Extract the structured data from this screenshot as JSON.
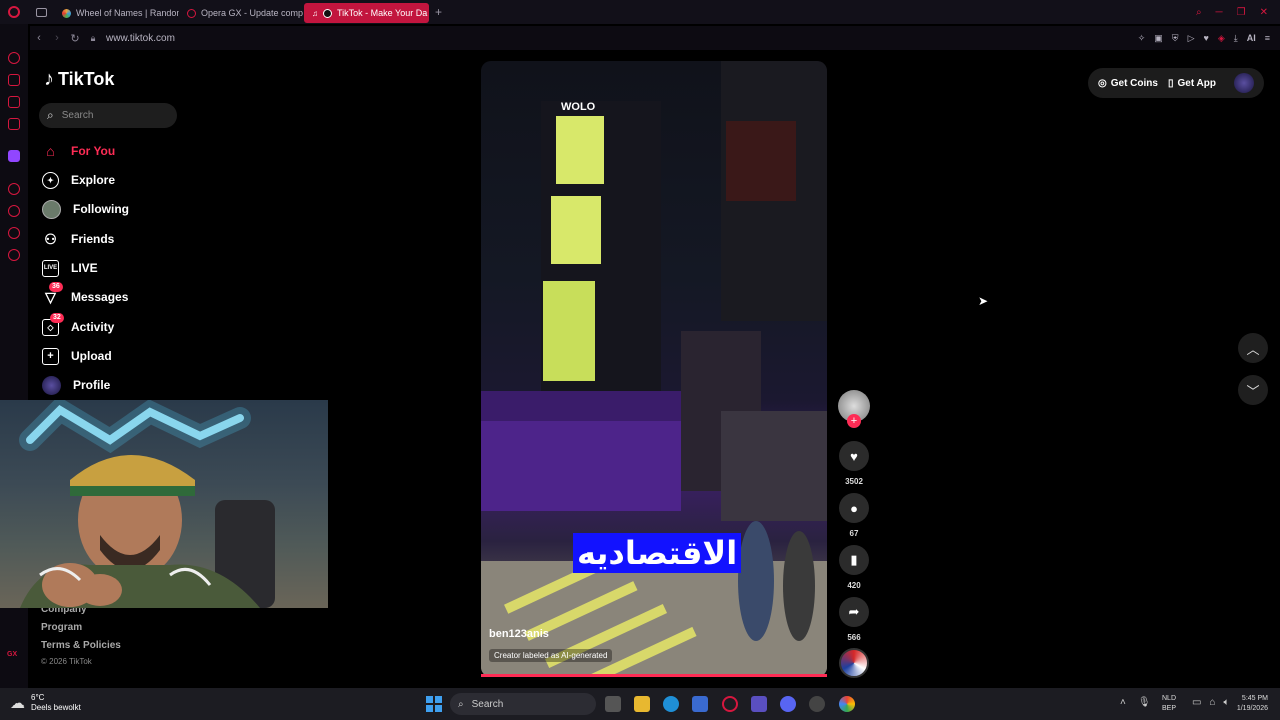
{
  "browser": {
    "tabs": [
      {
        "label": "Wheel of Names | Random",
        "color": "#e8a33c"
      },
      {
        "label": "Opera GX - Update comp",
        "color": "#d6173f"
      },
      {
        "label": "TikTok - Make Your Da",
        "color": "#111111"
      }
    ],
    "new_tab": "+",
    "url": "www.tiktok.com",
    "ai_label": "AI"
  },
  "tiktok": {
    "logo": "TikTok",
    "search_placeholder": "Search",
    "nav": [
      {
        "label": "For You",
        "icon": "home-icon",
        "active": true
      },
      {
        "label": "Explore",
        "icon": "compass-icon"
      },
      {
        "label": "Following",
        "icon": "following-avatar-icon"
      },
      {
        "label": "Friends",
        "icon": "friends-icon"
      },
      {
        "label": "LIVE",
        "icon": "live-tv-icon"
      },
      {
        "label": "Messages",
        "icon": "messages-icon",
        "badge": "36"
      },
      {
        "label": "Activity",
        "icon": "activity-icon",
        "badge": "32"
      },
      {
        "label": "Upload",
        "icon": "upload-icon"
      },
      {
        "label": "Profile",
        "icon": "profile-avatar-icon"
      }
    ],
    "footer": [
      "Company",
      "Program",
      "Terms & Policies",
      "© 2026 TikTok"
    ],
    "get_coins": "Get Coins",
    "get_app": "Get App",
    "accent": "#fe2c55"
  },
  "video": {
    "author": "ben123anis",
    "ai_label": "Creator labeled as AI-generated",
    "caption": "الاقتصاديه",
    "sign_text": "WOLO",
    "likes": "3502",
    "comments": "67",
    "saves": "420",
    "shares": "566"
  },
  "taskbar": {
    "weather_temp": "6°C",
    "weather_desc": "Deels bewolkt",
    "search": "Search",
    "lang1": "NLD",
    "lang2": "BEP",
    "time": "5:45 PM",
    "date": "1/19/2026"
  }
}
